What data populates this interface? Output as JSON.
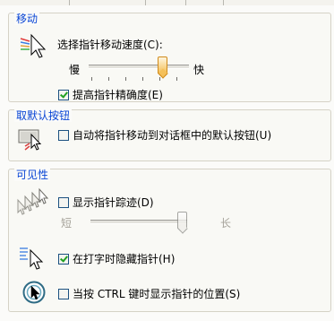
{
  "motion": {
    "title": "移动",
    "speed_label": "选择指针移动速度(C):",
    "slow": "慢",
    "fast": "快",
    "speed_level": 0.75,
    "precision_label": "提高指针精确度(E)",
    "precision_checked": true
  },
  "snap_to": {
    "title": "取默认按钮",
    "label": "自动将指针移动到对话框中的默认按钮(U)",
    "checked": false
  },
  "visibility": {
    "title": "可见性",
    "trails_label": "显示指针踪迹(D)",
    "trails_checked": false,
    "short": "短",
    "long": "长",
    "trail_level": 0.95,
    "hide_typing_label": "在打字时隐藏指针(H)",
    "hide_typing_checked": true,
    "show_ctrl_label": "当按 CTRL 键时显示指针的位置(S)",
    "show_ctrl_checked": false
  }
}
